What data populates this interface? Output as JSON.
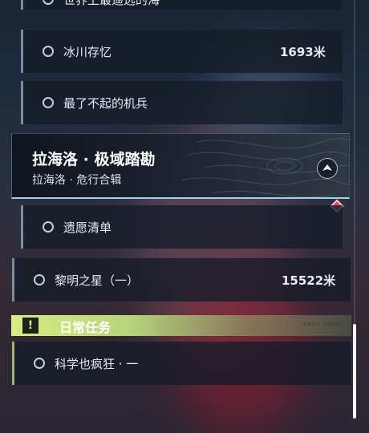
{
  "quests_above": [
    {
      "name": "世界上最遥远的海",
      "distance": ""
    },
    {
      "name": "冰川存忆",
      "distance": "1693米"
    },
    {
      "name": "最了不起的机兵",
      "distance": ""
    }
  ],
  "active_quest": {
    "title": "拉海洛 · 极域踏勘",
    "subtitle": "拉海洛 · 危行合辑",
    "icon": "navigate-arrow-icon"
  },
  "active_subquest": {
    "name": "遗愿清单",
    "distance": ""
  },
  "other_quest": {
    "name": "黎明之星（一）",
    "distance": "15522米"
  },
  "daily_section": {
    "label": "日常任务",
    "icon": "exclamation-icon",
    "tag": "DAILY QUEST",
    "accent": "#d6ee83"
  },
  "daily_quests": [
    {
      "name": "科学也疯狂 · 一",
      "distance": ""
    }
  ],
  "colors": {
    "marker": "#e0475c",
    "active_underline": "#9fd3e6"
  }
}
